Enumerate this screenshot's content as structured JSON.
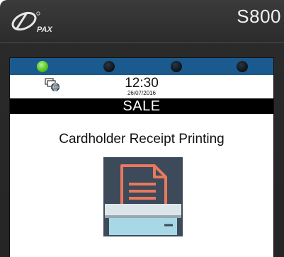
{
  "device": {
    "brand": "PAX",
    "model": "S800"
  },
  "status_bar": {
    "leds": [
      "green",
      "off",
      "off",
      "off",
      "off"
    ],
    "time": "12:30",
    "date": "26/07/2016",
    "network_icon": "network-globe-icon"
  },
  "screen": {
    "title": "SALE",
    "message": "Cardholder Receipt Printing",
    "illustration_icon": "receipt-printer-icon"
  },
  "colors": {
    "led_bar": "#1b5a8f",
    "title_bar": "#000000",
    "tile_background": "#3d4a5a",
    "paper_orange": "#e9795d",
    "printer_body": "#dce6ea",
    "printer_slot": "#a8d8e6"
  }
}
